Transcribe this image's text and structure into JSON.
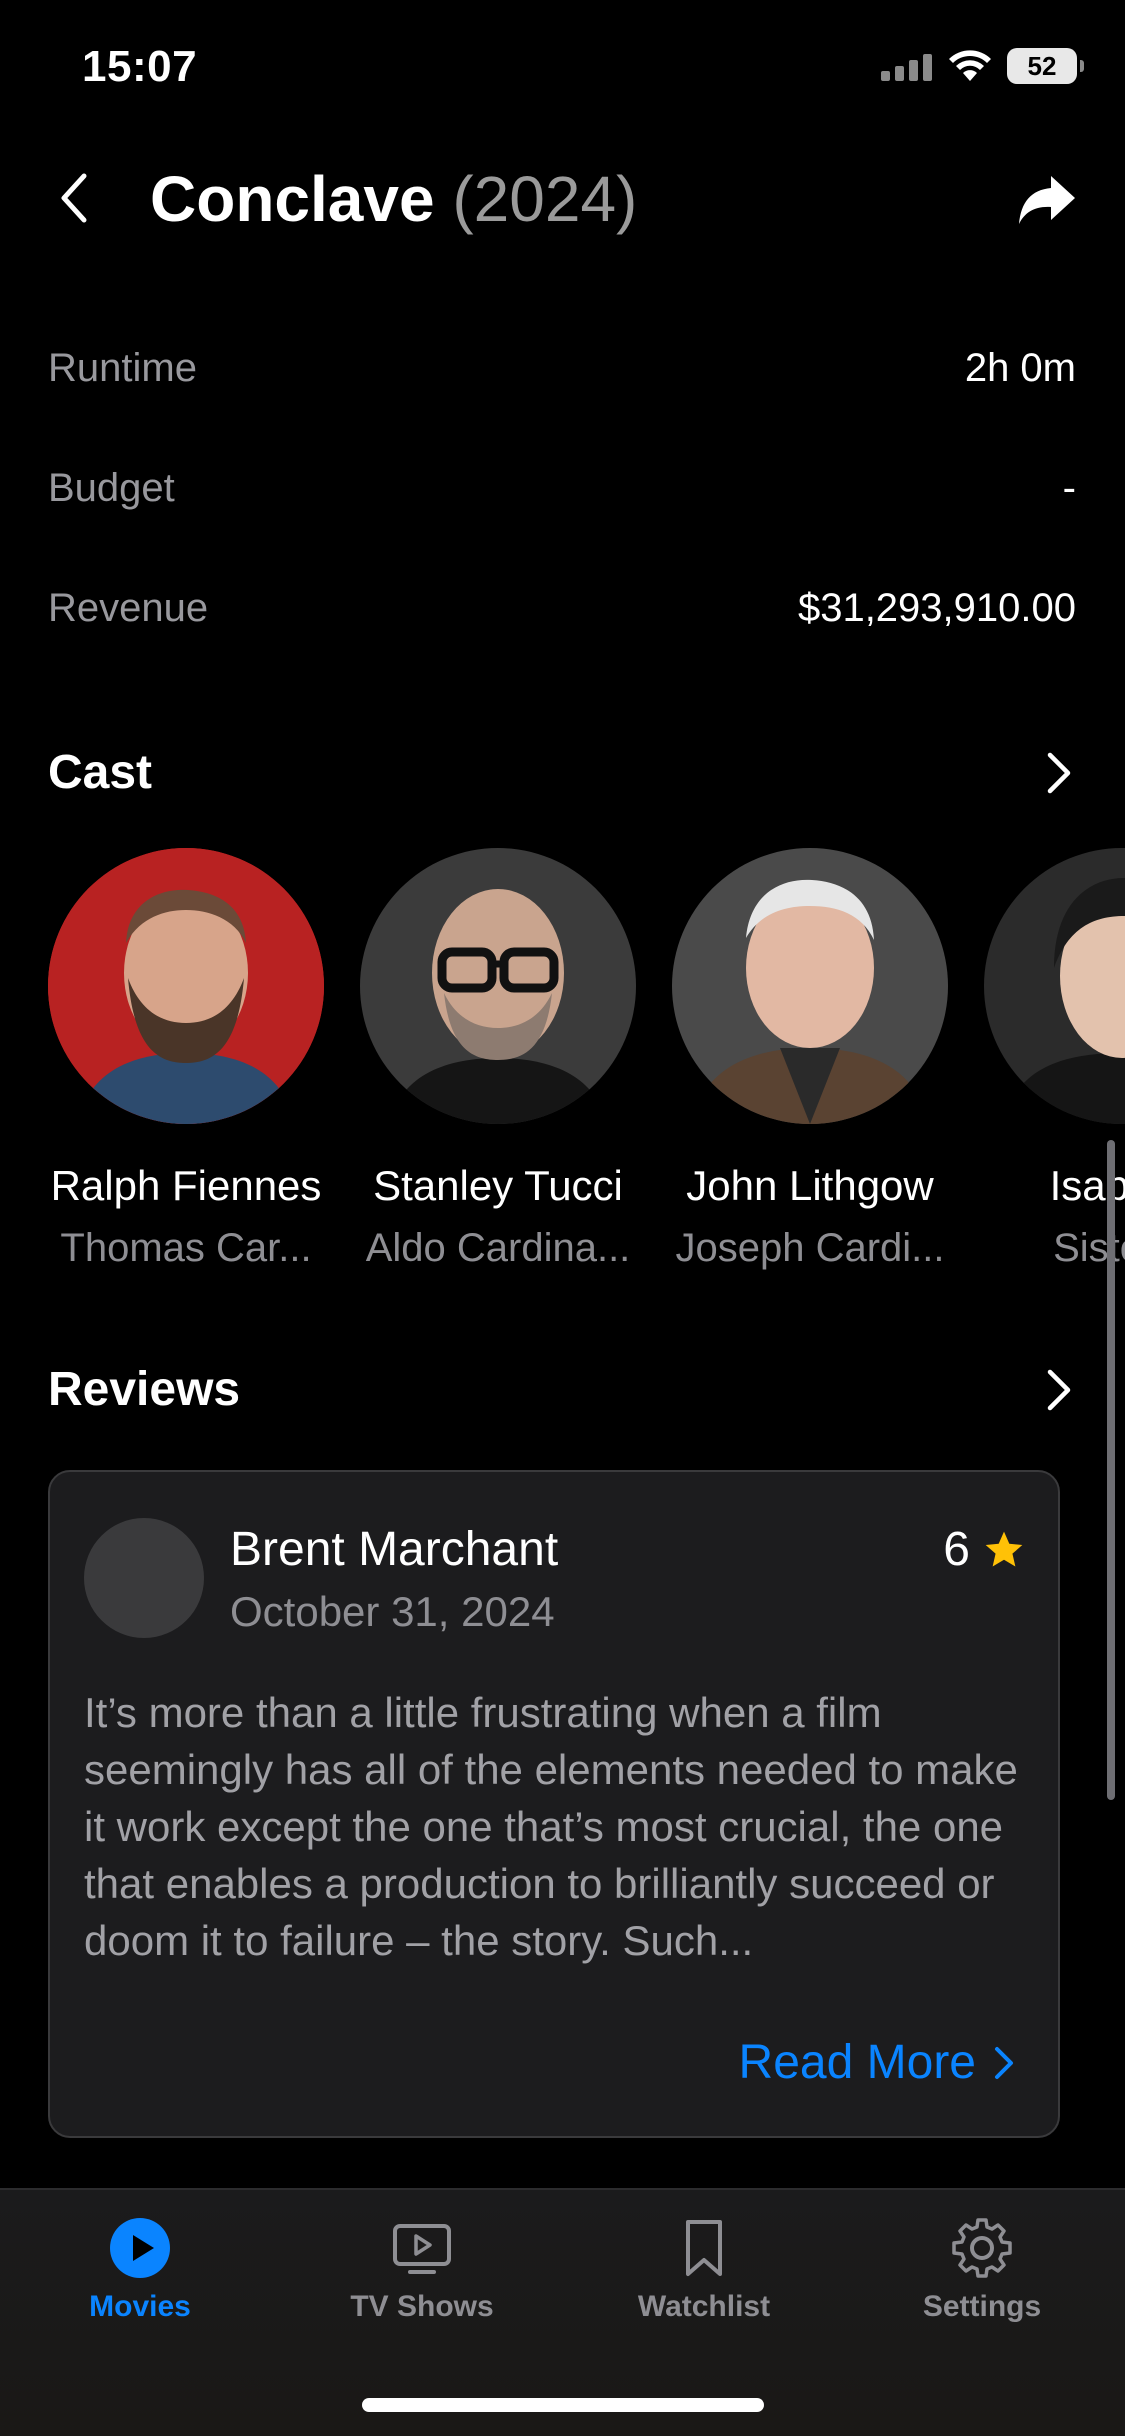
{
  "status_bar": {
    "time": "15:07",
    "battery": "52"
  },
  "nav": {
    "title": "Conclave",
    "year": "(2024)"
  },
  "details": [
    {
      "label": "Runtime",
      "value": "2h 0m"
    },
    {
      "label": "Budget",
      "value": "-"
    },
    {
      "label": "Revenue",
      "value": "$31,293,910.00"
    }
  ],
  "cast": {
    "title": "Cast",
    "members": [
      {
        "name": "Ralph Fiennes",
        "role": "Thomas Car..."
      },
      {
        "name": "Stanley Tucci",
        "role": "Aldo Cardina..."
      },
      {
        "name": "John Lithgow",
        "role": "Joseph Cardi..."
      },
      {
        "name": "Isabella",
        "role": "Sister A"
      }
    ]
  },
  "reviews": {
    "title": "Reviews",
    "items": [
      {
        "author": "Brent Marchant",
        "date": "October 31, 2024",
        "rating": "6",
        "text": "It’s more than a little frustrating when a film seemingly has all of the elements needed to make it work except the one that’s most crucial, the one that enables a production to brilliantly succeed or doom it to failure – the story. Such...",
        "read_more": "Read More"
      }
    ]
  },
  "tabs": [
    {
      "label": "Movies",
      "icon": "play-circle-icon",
      "active": true
    },
    {
      "label": "TV Shows",
      "icon": "tv-icon",
      "active": false
    },
    {
      "label": "Watchlist",
      "icon": "bookmark-icon",
      "active": false
    },
    {
      "label": "Settings",
      "icon": "gear-icon",
      "active": false
    }
  ],
  "colors": {
    "accent": "#0a84ff",
    "star": "#ffc107",
    "background": "#000000",
    "card": "#1c1c1e"
  }
}
